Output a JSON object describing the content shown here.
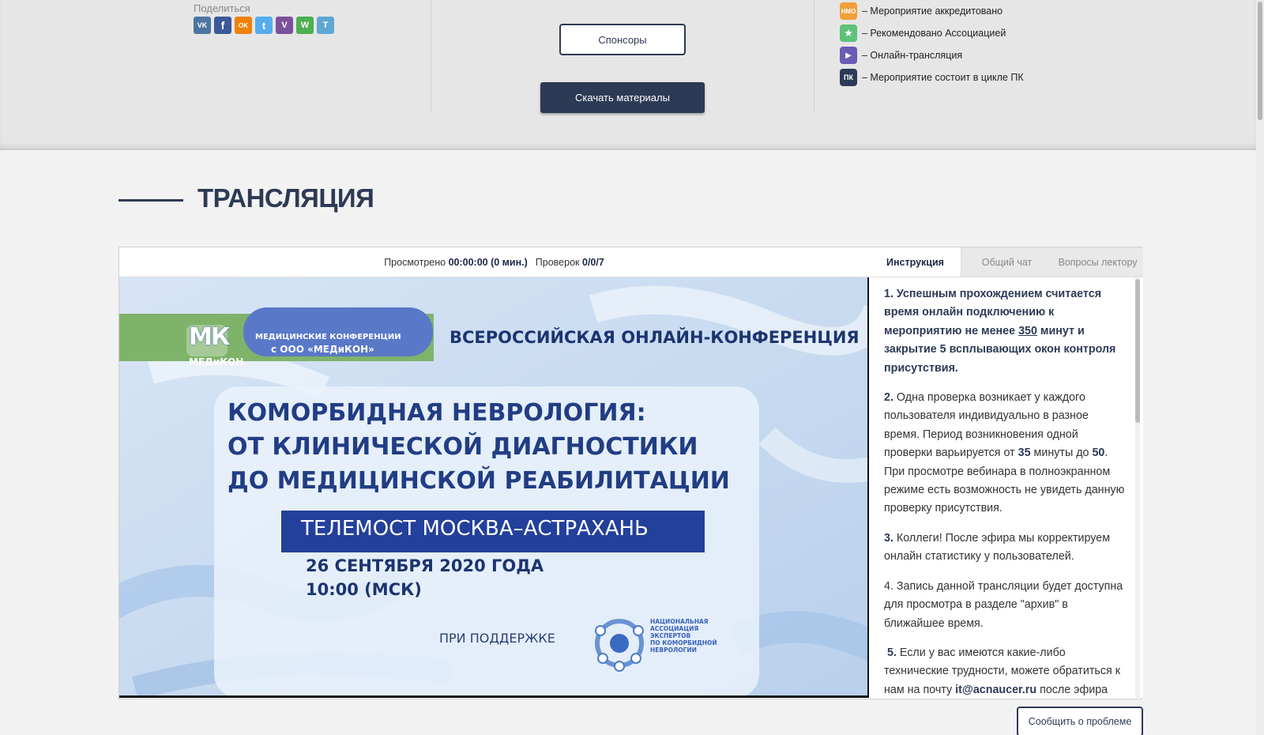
{
  "share": {
    "label": "Поделиться",
    "networks": [
      {
        "name": "vk",
        "glyph": "VK",
        "color": "#4c75a3"
      },
      {
        "name": "facebook",
        "glyph": "f",
        "color": "#3b5998"
      },
      {
        "name": "odnoklassniki",
        "glyph": "OK",
        "color": "#ee8208"
      },
      {
        "name": "twitter",
        "glyph": "t",
        "color": "#55acee"
      },
      {
        "name": "viber",
        "glyph": "V",
        "color": "#7b519d"
      },
      {
        "name": "whatsapp",
        "glyph": "W",
        "color": "#4caf50"
      },
      {
        "name": "telegram",
        "glyph": "T",
        "color": "#5fa8d3"
      }
    ]
  },
  "buttons": {
    "sponsors": "Спонсоры",
    "download": "Скачать материалы",
    "report": "Сообщить о проблеме"
  },
  "legend": [
    {
      "badge": "НМО",
      "icon": "nmo-badge-icon",
      "color": "#f0a03c",
      "text": "– Мероприятие аккредитовано"
    },
    {
      "badge": "★",
      "icon": "star-badge-icon",
      "color": "#5fc17a",
      "text": "– Рекомендовано Ассоциацией"
    },
    {
      "badge": "▶",
      "icon": "video-camera-icon",
      "color": "#6a5cb3",
      "text": "– Онлайн-трансляция"
    },
    {
      "badge": "ПК",
      "icon": "pk-badge-icon",
      "color": "#2d3a55",
      "text": "– Мероприятие состоит в цикле ПК"
    }
  ],
  "section": {
    "title": "ТРАНСЛЯЦИЯ"
  },
  "stats": {
    "watched_label": "Просмотрено",
    "watched_value": "00:00:00 (0 мин.)",
    "checks_label": "Проверок",
    "checks_value": "0/0/7"
  },
  "tabs": [
    {
      "label": "Инструкция",
      "active": true
    },
    {
      "label": "Общий чат",
      "active": false
    },
    {
      "label": "Вопросы лектору",
      "active": false
    }
  ],
  "video": {
    "logo_org_line1": "МЕДИЦИНСКИЕ КОНФЕРЕНЦИИ",
    "logo_org_line2": "с ООО «МЕДиКОН»",
    "logo_brand": "МЕДиКОН",
    "logo_mark": "МК",
    "header": "ВСЕРОССИЙСКАЯ ОНЛАЙН-КОНФЕРЕНЦИЯ",
    "title_line1": "КОМОРБИДНАЯ НЕВРОЛОГИЯ:",
    "title_line2": "ОТ КЛИНИЧЕСКОЙ ДИАГНОСТИКИ",
    "title_line3": "ДО МЕДИЦИНСКОЙ РЕАБИЛИТАЦИИ",
    "banner": "ТЕЛЕМОСТ МОСКВА–АСТРАХАНЬ",
    "date": "26 СЕНТЯБРЯ 2020 ГОДА",
    "time": "10:00 (МСК)",
    "support": "ПРИ ПОДДЕРЖКЕ",
    "assoc_line1": "НАЦИОНАЛЬНАЯ",
    "assoc_line2": "АССОЦИАЦИЯ",
    "assoc_line3": "ЭКСПЕРТОВ",
    "assoc_line4": "ПО КОМОРБИДНОЙ",
    "assoc_line5": "НЕВРОЛОГИИ"
  },
  "instructions": {
    "p1_num": "1.",
    "p1_a": "Успешным прохождением считается время онлайн подключению к мероприятию не менее",
    "p1_minutes": "350",
    "p1_b": "минут и закрытие 5 всплывающих окон контроля присутствия.",
    "p2_num": "2.",
    "p2_a": "Одна проверка возникает у каждого пользователя индивидуально в разное время. Период возникновения одной проверки варьируется от",
    "p2_from": "35",
    "p2_mid": "минуты до",
    "p2_to": "50",
    "p2_b": ". При просмотре вебинара в полноэкранном режиме есть возможность не увидеть данную проверку присутствия.",
    "p3_num": "3.",
    "p3": "Коллеги! После эфира мы корректируем онлайн статистику у пользователей.",
    "p4": "4. Запись данной трансляции будет доступна для просмотра в разделе \"архив\" в ближайшее время.",
    "p5_num": "5.",
    "p5_a": "Если у вас имеются какие-либо технические трудности, можете обратиться к нам на почту",
    "p5_email": "it@acnaucer.ru",
    "p5_b": "после эфира"
  }
}
